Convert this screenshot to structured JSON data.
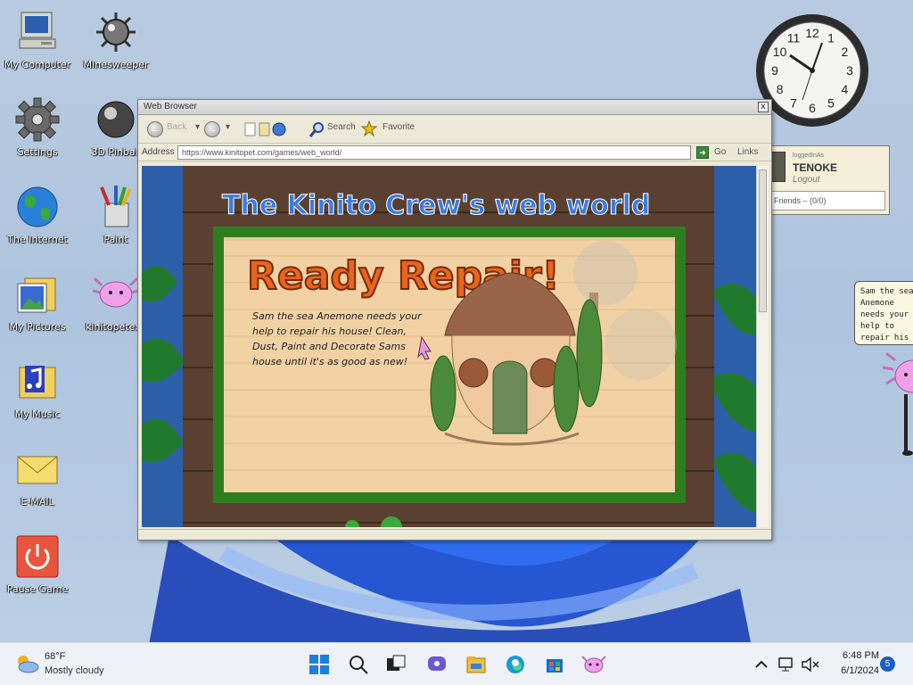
{
  "desktop": {
    "icons": [
      {
        "label": "My Computer"
      },
      {
        "label": "Minesweeper"
      },
      {
        "label": "Settings"
      },
      {
        "label": "3D Pinball"
      },
      {
        "label": "The Internet"
      },
      {
        "label": "Paint"
      },
      {
        "label": "My Pictures"
      },
      {
        "label": "kinitopetexe"
      },
      {
        "label": "My Music"
      },
      {
        "label": "E-MAIL"
      },
      {
        "label": "Pause Game"
      }
    ]
  },
  "clock_widget": {
    "numbers": [
      "12",
      "1",
      "2",
      "3",
      "4",
      "5",
      "6",
      "7",
      "8",
      "9",
      "10",
      "11"
    ]
  },
  "login_widget": {
    "small_text": "loggedInAs",
    "username": "TENOKE",
    "logout": "Logout",
    "friends": "Friends – (0/0)"
  },
  "speech_bubble": {
    "text": "Sam the sea Anemone needs your help to repair his house!"
  },
  "browser": {
    "title": "Web Browser",
    "close_label": "x",
    "toolbar": {
      "back_label": "Back",
      "search_label": "Search",
      "favorite_label": "Favorite"
    },
    "address": {
      "label": "Address",
      "url": "https://www.kinitopet.com/games/web_world/",
      "go_label": "Go",
      "links_label": "Links"
    },
    "page": {
      "site_title": "The Kinito Crew's web world",
      "game_title": "Ready Repair!",
      "description": "Sam the sea Anemone needs your help to repair his house! Clean, Dust, Paint and Decorate Sams house until it's as good as new!"
    }
  },
  "taskbar": {
    "weather_temp": "68°F",
    "weather_desc": "Mostly cloudy",
    "time": "6:48 PM",
    "date": "6/1/2024",
    "notification_count": "5"
  },
  "colors": {
    "title_blue": "#3a7be0",
    "title_purple": "#8a3fe0",
    "title_pink": "#e04a7a",
    "title_red": "#e0332a",
    "title_orange": "#e88a1c",
    "ready_repair_orange": "#e8651c",
    "grass_green": "#2e7d1f",
    "wood_brown": "#5a4030"
  }
}
